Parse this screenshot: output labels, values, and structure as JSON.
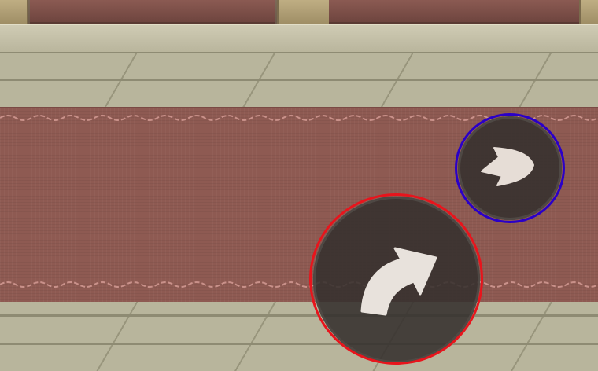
{
  "scene": {
    "type": "top-down RPG room",
    "carpet_color": "#8e5a52",
    "floor_color": "#b8b59c",
    "carpet_pattern_color": "#c9918a"
  },
  "buttons": [
    {
      "id": "main",
      "icon": "curved-arrow-icon",
      "highlight_color": "#e8141c"
    },
    {
      "id": "secondary",
      "icon": "dash-arrow-icon",
      "highlight_color": "#2a00c8"
    }
  ]
}
